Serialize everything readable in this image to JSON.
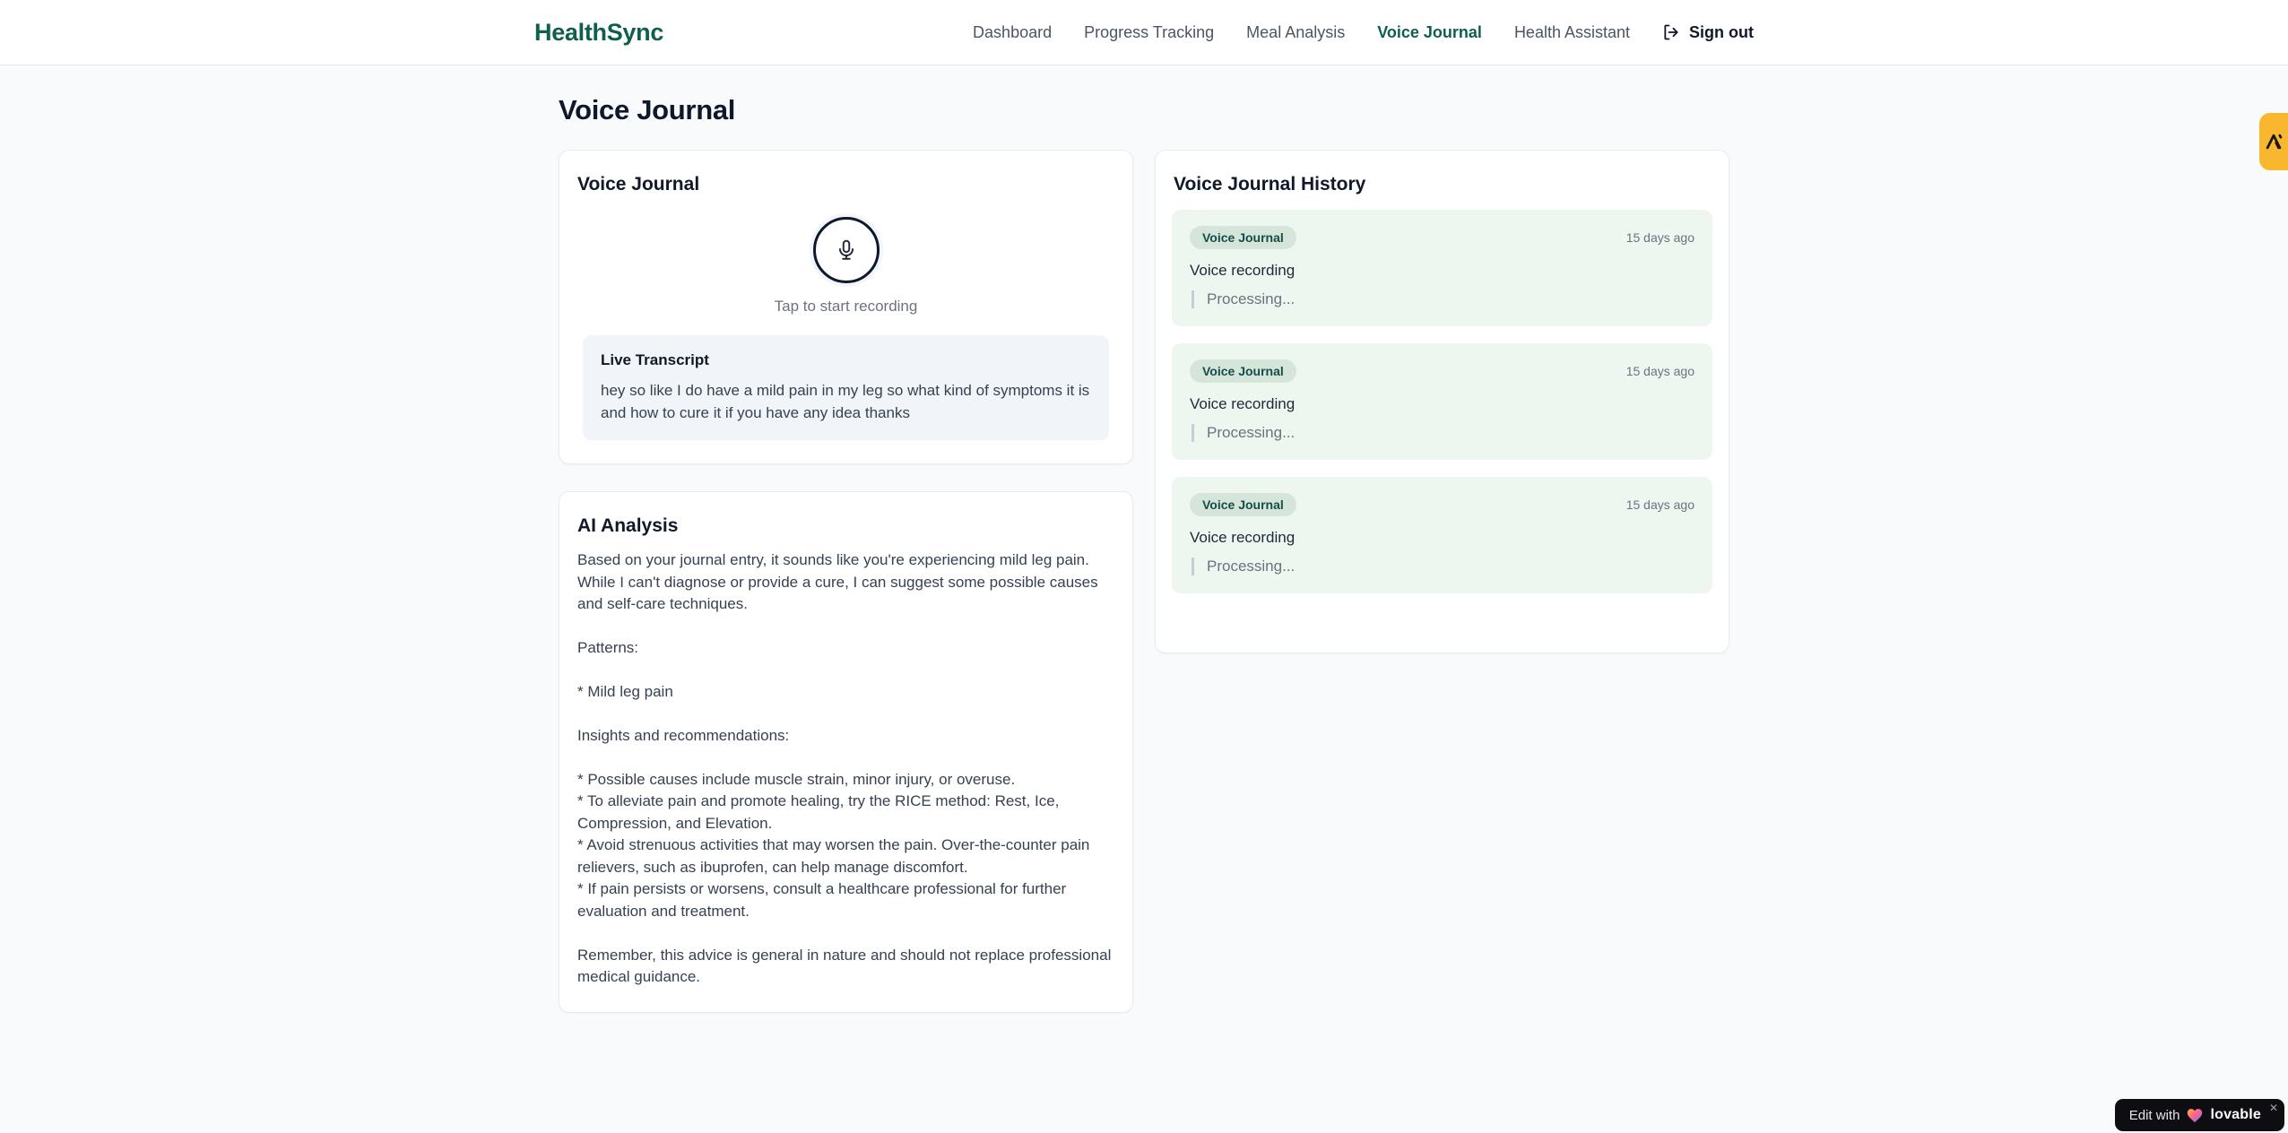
{
  "header": {
    "logo": "HealthSync",
    "nav": [
      {
        "label": "Dashboard",
        "active": false
      },
      {
        "label": "Progress Tracking",
        "active": false
      },
      {
        "label": "Meal Analysis",
        "active": false
      },
      {
        "label": "Voice Journal",
        "active": true
      },
      {
        "label": "Health Assistant",
        "active": false
      }
    ],
    "sign_out_label": "Sign out"
  },
  "page": {
    "title": "Voice Journal"
  },
  "recorder": {
    "card_title": "Voice Journal",
    "tap_hint": "Tap to start recording",
    "transcript_title": "Live Transcript",
    "transcript_text": "hey so like I do have a mild pain in my leg so what kind of symptoms it is and how to cure it if you have any idea thanks"
  },
  "analysis": {
    "card_title": "AI Analysis",
    "body": "Based on your journal entry, it sounds like you're experiencing mild leg pain. While I can't diagnose or provide a cure, I can suggest some possible causes and self-care techniques.\n\nPatterns:\n\n* Mild leg pain\n\nInsights and recommendations:\n\n* Possible causes include muscle strain, minor injury, or overuse.\n* To alleviate pain and promote healing, try the RICE method: Rest, Ice, Compression, and Elevation.\n* Avoid strenuous activities that may worsen the pain. Over-the-counter pain relievers, such as ibuprofen, can help manage discomfort.\n* If pain persists or worsens, consult a healthcare professional for further evaluation and treatment.\n\nRemember, this advice is general in nature and should not replace professional medical guidance."
  },
  "history": {
    "card_title": "Voice Journal History",
    "entries": [
      {
        "badge": "Voice Journal",
        "time": "15 days ago",
        "title": "Voice recording",
        "status": "Processing..."
      },
      {
        "badge": "Voice Journal",
        "time": "15 days ago",
        "title": "Voice recording",
        "status": "Processing..."
      },
      {
        "badge": "Voice Journal",
        "time": "15 days ago",
        "title": "Voice recording",
        "status": "Processing..."
      }
    ]
  },
  "widgets": {
    "lovable": {
      "prefix": "Edit with",
      "brand": "lovable",
      "close": "✕"
    }
  },
  "colors": {
    "accent_teal": "#0f5f4f",
    "page_bg": "#f8fafc",
    "history_entry_bg": "#edf6ef",
    "badge_pill_bg": "#d6e5da",
    "side_badge_amber": "#f9b62f",
    "lovable_bg": "#0d0d12"
  }
}
